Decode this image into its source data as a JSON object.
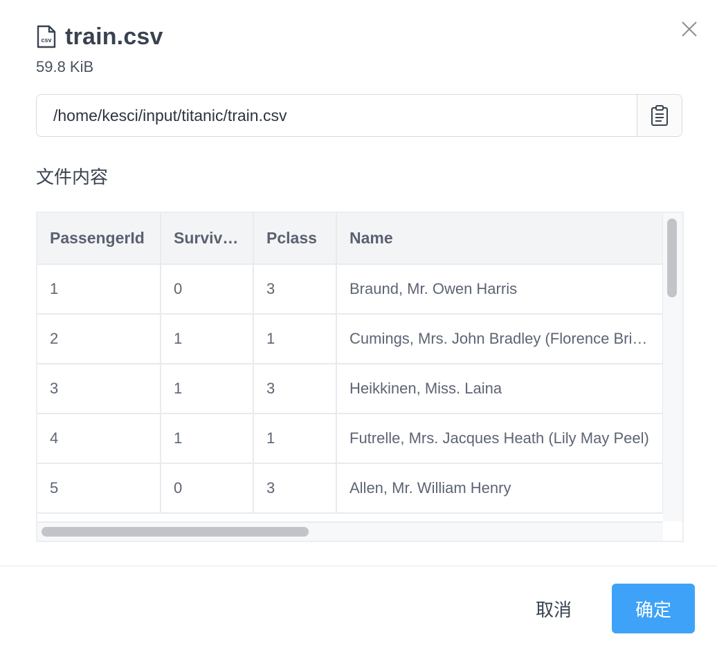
{
  "header": {
    "file_icon": "csv-file-icon",
    "file_icon_text": "csv",
    "title": "train.csv",
    "size": "59.8 KiB",
    "close_icon": "close-icon"
  },
  "path": {
    "value": "/home/kesci/input/titanic/train.csv",
    "copy_icon": "clipboard-icon"
  },
  "content_section": {
    "title": "文件内容"
  },
  "table": {
    "columns": [
      "PassengerId",
      "Survived",
      "Pclass",
      "Name"
    ],
    "rows": [
      [
        "1",
        "0",
        "3",
        "Braund, Mr. Owen Harris"
      ],
      [
        "2",
        "1",
        "1",
        "Cumings, Mrs. John Bradley (Florence Briggs Thayer)"
      ],
      [
        "3",
        "1",
        "3",
        "Heikkinen, Miss. Laina"
      ],
      [
        "4",
        "1",
        "1",
        "Futrelle, Mrs. Jacques Heath (Lily May Peel)"
      ],
      [
        "5",
        "0",
        "3",
        "Allen, Mr. William Henry"
      ]
    ]
  },
  "footer": {
    "cancel_label": "取消",
    "ok_label": "确定"
  },
  "colors": {
    "primary": "#3ea2f8",
    "header_bg": "#f3f4f6",
    "border": "#d6d9de"
  }
}
